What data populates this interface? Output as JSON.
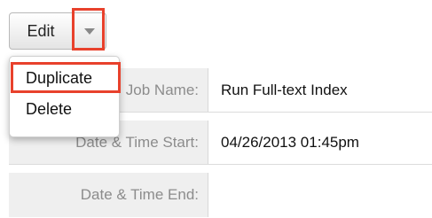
{
  "actions": {
    "edit_label": "Edit",
    "caret_icon": "chevron-down-icon"
  },
  "dropdown": {
    "items": [
      {
        "label": "Duplicate",
        "highlighted": true
      },
      {
        "label": "Delete",
        "highlighted": false
      }
    ]
  },
  "detail": {
    "rows": [
      {
        "label": "Job Name:",
        "value": "Run Full-text Index"
      },
      {
        "label": "Date & Time Start:",
        "value": "04/26/2013 01:45pm"
      },
      {
        "label": "Date & Time End:",
        "value": ""
      }
    ]
  },
  "colors": {
    "highlight": "#e8412c",
    "label_bg": "#efefef",
    "label_text": "#8c8c8c"
  }
}
